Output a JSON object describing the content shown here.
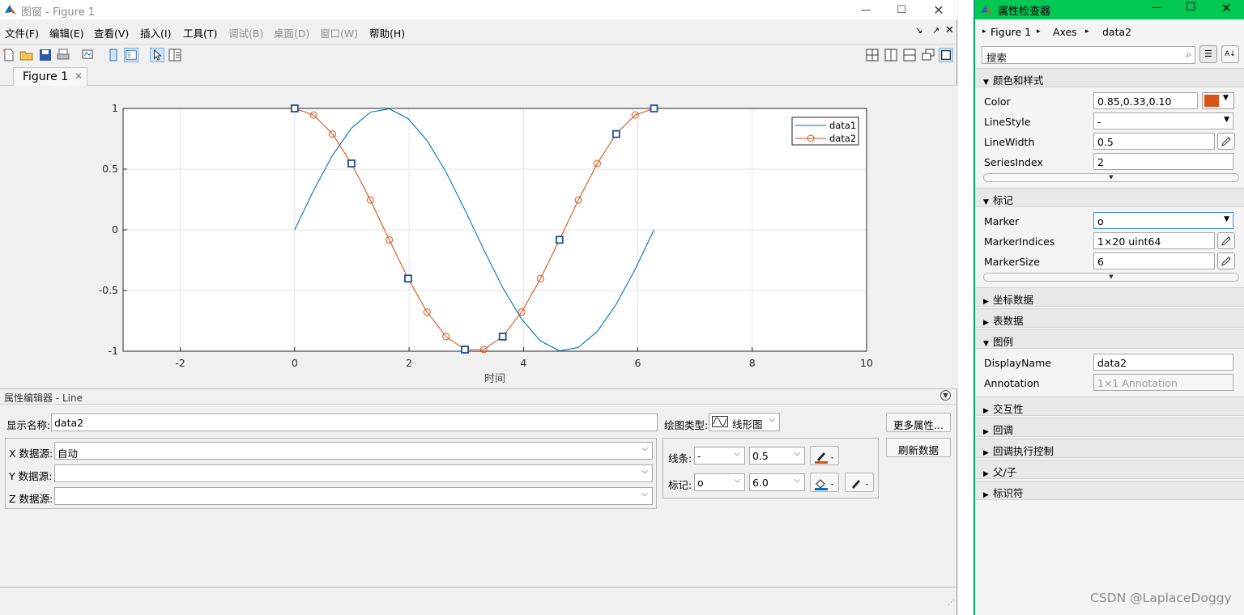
{
  "figure_window": {
    "title": "图窗 - Figure 1",
    "menu": [
      "文件(F)",
      "编辑(E)",
      "查看(V)",
      "插入(I)",
      "工具(T)",
      "调试(B)",
      "桌面(D)",
      "窗口(W)",
      "帮助(H)"
    ],
    "disabled_menu_indexes": [
      5,
      6,
      7
    ],
    "tab": "Figure 1",
    "colors": {
      "accent": "#0072bd",
      "orange": "#d95319",
      "inspector_title": "#00c853"
    }
  },
  "chart_data": {
    "type": "line",
    "xlabel": "时间",
    "ylabel": "",
    "xlim": [
      -3,
      10
    ],
    "ylim": [
      -1,
      1
    ],
    "xticks": [
      -2,
      0,
      2,
      4,
      6,
      8,
      10
    ],
    "yticks": [
      -1,
      -0.5,
      0,
      0.5,
      1
    ],
    "xtick_labels": [
      "-2",
      "0",
      "2",
      "4",
      "6",
      "8",
      "10"
    ],
    "ytick_labels": [
      "-1",
      "-0.5",
      "0",
      "0.5",
      "1"
    ],
    "grid": true,
    "legend_position": "top-right",
    "series": [
      {
        "name": "data1",
        "color": "#0072bd",
        "marker": "none",
        "x": [
          0,
          0.3307,
          0.6614,
          0.9921,
          1.3228,
          1.6535,
          1.9842,
          2.3149,
          2.6456,
          2.9762,
          3.3069,
          3.6376,
          3.9683,
          4.299,
          4.6297,
          4.9604,
          5.2911,
          5.6218,
          5.9525,
          6.2832
        ],
        "y": [
          0,
          0.3247,
          0.6142,
          0.8372,
          0.9694,
          0.9966,
          0.9158,
          0.7357,
          0.4759,
          0.1646,
          -0.1646,
          -0.4759,
          -0.7357,
          -0.9158,
          -0.9966,
          -0.9694,
          -0.8372,
          -0.6142,
          -0.3247,
          0
        ]
      },
      {
        "name": "data2",
        "color": "#d95319",
        "marker": "o",
        "x": [
          0,
          0.3307,
          0.6614,
          0.9921,
          1.3228,
          1.6535,
          1.9842,
          2.3149,
          2.6456,
          2.9762,
          3.3069,
          3.6376,
          3.9683,
          4.299,
          4.6297,
          4.9604,
          5.2911,
          5.6218,
          5.9525,
          6.2832
        ],
        "y": [
          1,
          0.9458,
          0.7891,
          0.5469,
          0.2455,
          -0.0826,
          -0.4017,
          -0.6773,
          -0.8795,
          -0.9864,
          -0.9864,
          -0.8795,
          -0.6773,
          -0.4017,
          -0.0826,
          0.2455,
          0.5469,
          0.7891,
          0.9458,
          1
        ]
      }
    ],
    "highlight_indices": [
      0,
      3,
      6,
      9,
      11,
      14,
      17,
      19
    ]
  },
  "property_editor": {
    "title": "属性编辑器 - Line",
    "display_name_label": "显示名称:",
    "display_name": "data2",
    "plot_type_label": "绘图类型:",
    "plot_type": "线形图",
    "x_source_label": "X 数据源:",
    "x_source": "自动",
    "y_source_label": "Y 数据源:",
    "y_source": "",
    "z_source_label": "Z 数据源:",
    "z_source": "",
    "line_label": "线条:",
    "line_style": "-",
    "line_width": "0.5",
    "marker_label": "标记:",
    "marker": "o",
    "marker_size": "6.0",
    "more_props": "更多属性...",
    "refresh": "刷新数据"
  },
  "inspector": {
    "title": "属性检查器",
    "breadcrumb": [
      "Figure 1",
      "Axes",
      "data2"
    ],
    "search_placeholder": "搜索",
    "sections": {
      "color_style": "颜色和样式",
      "markers": "标记",
      "coordinate_data": "坐标数据",
      "table_data": "表数据",
      "legend": "图例",
      "interactivity": "交互性",
      "callbacks": "回调",
      "callback_exec": "回调执行控制",
      "parent_child": "父/子",
      "identifiers": "标识符"
    },
    "props": {
      "color": {
        "label": "Color",
        "value": "0.85,0.33,0.10",
        "swatch": "#d95319"
      },
      "linestyle": {
        "label": "LineStyle",
        "value": "-"
      },
      "linewidth": {
        "label": "LineWidth",
        "value": "0.5"
      },
      "seriesindex": {
        "label": "SeriesIndex",
        "value": "2"
      },
      "marker": {
        "label": "Marker",
        "value": "o"
      },
      "markerindices": {
        "label": "MarkerIndices",
        "value": "1×20 uint64"
      },
      "markersize": {
        "label": "MarkerSize",
        "value": "6"
      },
      "displayname": {
        "label": "DisplayName",
        "value": "data2"
      },
      "annotation": {
        "label": "Annotation",
        "value": "1×1 Annotation"
      }
    }
  },
  "watermark": "CSDN @LaplaceDoggy"
}
